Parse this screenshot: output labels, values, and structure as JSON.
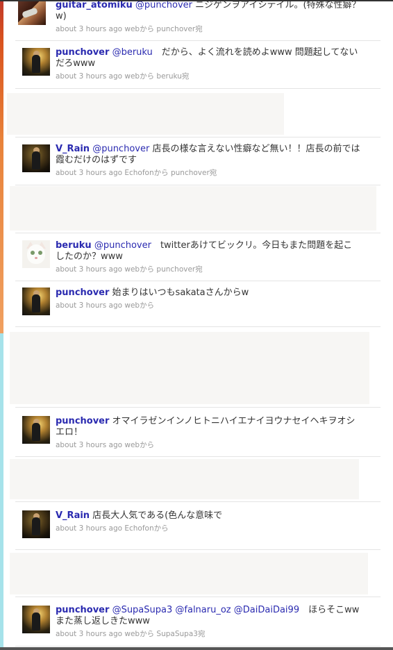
{
  "tweets": [
    {
      "user": "guitar_atomiku",
      "mentions": [
        "@punchover"
      ],
      "body": " ニジゲンヲアイシテイル。(特殊な性癖？w)",
      "meta": "about 3 hours ago webから punchover宛",
      "avatar": "guitar-photo"
    },
    {
      "user": "punchover",
      "mentions": [
        "@beruku"
      ],
      "body": "　だから、よく流れを読めよwww  問題起してないだろwww",
      "meta": "about 3 hours ago webから beruku宛",
      "avatar": "band-photo"
    },
    {
      "user": "V_Rain",
      "mentions": [
        "@punchover"
      ],
      "body": " 店長の様な言えない性癖など無い！！店長の前では霞むだけのはずです",
      "meta": "about 3 hours ago Echofonから punchover宛",
      "avatar": "stage-photo"
    },
    {
      "user": "beruku",
      "mentions": [
        "@punchover"
      ],
      "body": "　twitterあけてビックリ。今日もまた問題を起こしたのか？www",
      "meta": "about 3 hours ago webから punchover宛",
      "avatar": "cat-photo"
    },
    {
      "user": "punchover",
      "mentions": [],
      "body": " 始まりはいつもsakataさんからw",
      "meta": "about 3 hours ago webから",
      "avatar": "band-photo"
    },
    {
      "user": "punchover",
      "mentions": [],
      "body": " オマイラゼンインノヒトニハイエナイヨウナセイヘキヲオシエロ！",
      "meta": "about 3 hours ago webから",
      "avatar": "band-photo"
    },
    {
      "user": "V_Rain",
      "mentions": [],
      "body": " 店長大人気である(色んな意味で",
      "meta": "about 3 hours ago Echofonから",
      "avatar": "stage-photo"
    },
    {
      "user": "punchover",
      "mentions": [
        "@SupaSupa3",
        "@falnaru_oz",
        "@DaiDaiDai99"
      ],
      "body": "　ほらそこww  また蒸し返しきたwww",
      "meta": "about 3 hours ago webから SupaSupa3宛",
      "avatar": "band-photo"
    }
  ]
}
